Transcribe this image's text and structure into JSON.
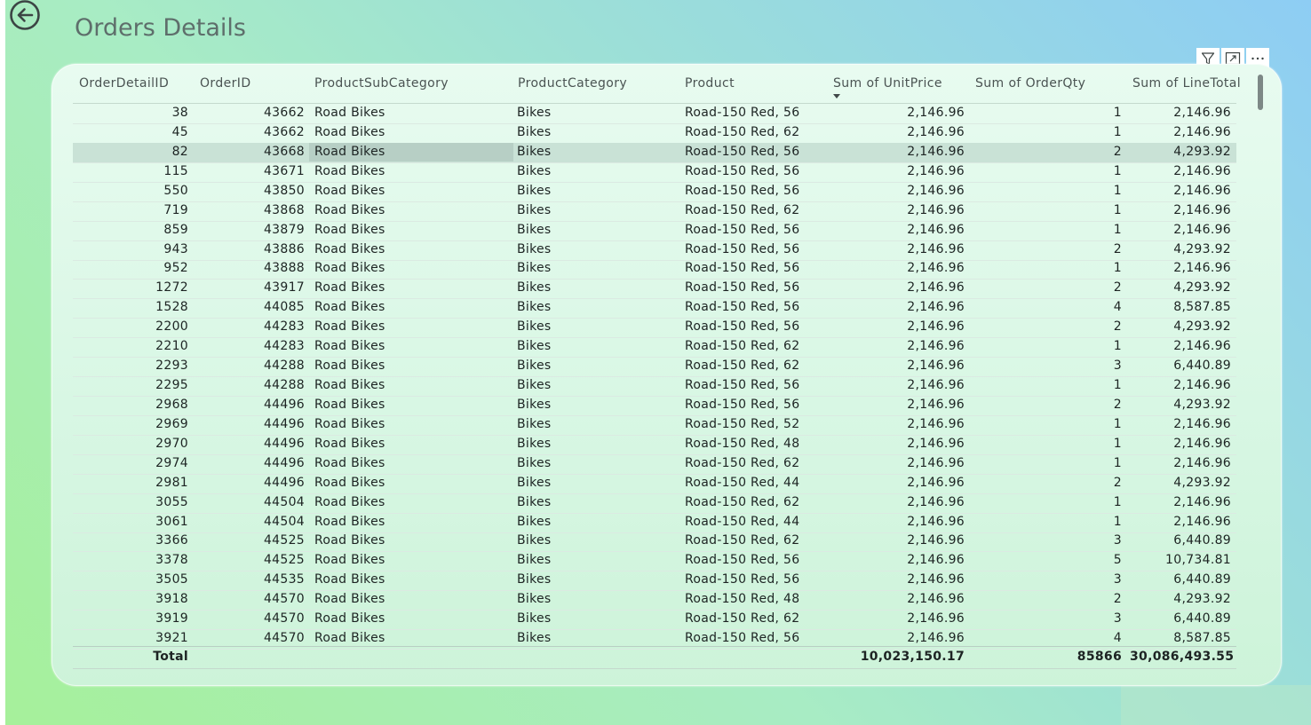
{
  "page": {
    "title": "Orders Details"
  },
  "toolbar": {
    "icons": [
      "filter-icon",
      "focus-mode-icon",
      "more-options-icon"
    ]
  },
  "table": {
    "columns": [
      "OrderDetailID",
      "OrderID",
      "ProductSubCategory",
      "ProductCategory",
      "Product",
      "Sum of UnitPrice",
      "Sum of OrderQty",
      "Sum of LineTotal"
    ],
    "sorted_column": "Sum of UnitPrice",
    "selected_row": 2,
    "rows": [
      [
        "38",
        "43662",
        "Road Bikes",
        "Bikes",
        "Road-150 Red, 56",
        "2,146.96",
        "1",
        "2,146.96"
      ],
      [
        "45",
        "43662",
        "Road Bikes",
        "Bikes",
        "Road-150 Red, 62",
        "2,146.96",
        "1",
        "2,146.96"
      ],
      [
        "82",
        "43668",
        "Road Bikes",
        "Bikes",
        "Road-150 Red, 56",
        "2,146.96",
        "2",
        "4,293.92"
      ],
      [
        "115",
        "43671",
        "Road Bikes",
        "Bikes",
        "Road-150 Red, 56",
        "2,146.96",
        "1",
        "2,146.96"
      ],
      [
        "550",
        "43850",
        "Road Bikes",
        "Bikes",
        "Road-150 Red, 56",
        "2,146.96",
        "1",
        "2,146.96"
      ],
      [
        "719",
        "43868",
        "Road Bikes",
        "Bikes",
        "Road-150 Red, 62",
        "2,146.96",
        "1",
        "2,146.96"
      ],
      [
        "859",
        "43879",
        "Road Bikes",
        "Bikes",
        "Road-150 Red, 56",
        "2,146.96",
        "1",
        "2,146.96"
      ],
      [
        "943",
        "43886",
        "Road Bikes",
        "Bikes",
        "Road-150 Red, 56",
        "2,146.96",
        "2",
        "4,293.92"
      ],
      [
        "952",
        "43888",
        "Road Bikes",
        "Bikes",
        "Road-150 Red, 56",
        "2,146.96",
        "1",
        "2,146.96"
      ],
      [
        "1272",
        "43917",
        "Road Bikes",
        "Bikes",
        "Road-150 Red, 56",
        "2,146.96",
        "2",
        "4,293.92"
      ],
      [
        "1528",
        "44085",
        "Road Bikes",
        "Bikes",
        "Road-150 Red, 56",
        "2,146.96",
        "4",
        "8,587.85"
      ],
      [
        "2200",
        "44283",
        "Road Bikes",
        "Bikes",
        "Road-150 Red, 56",
        "2,146.96",
        "2",
        "4,293.92"
      ],
      [
        "2210",
        "44283",
        "Road Bikes",
        "Bikes",
        "Road-150 Red, 62",
        "2,146.96",
        "1",
        "2,146.96"
      ],
      [
        "2293",
        "44288",
        "Road Bikes",
        "Bikes",
        "Road-150 Red, 62",
        "2,146.96",
        "3",
        "6,440.89"
      ],
      [
        "2295",
        "44288",
        "Road Bikes",
        "Bikes",
        "Road-150 Red, 56",
        "2,146.96",
        "1",
        "2,146.96"
      ],
      [
        "2968",
        "44496",
        "Road Bikes",
        "Bikes",
        "Road-150 Red, 56",
        "2,146.96",
        "2",
        "4,293.92"
      ],
      [
        "2969",
        "44496",
        "Road Bikes",
        "Bikes",
        "Road-150 Red, 52",
        "2,146.96",
        "1",
        "2,146.96"
      ],
      [
        "2970",
        "44496",
        "Road Bikes",
        "Bikes",
        "Road-150 Red, 48",
        "2,146.96",
        "1",
        "2,146.96"
      ],
      [
        "2974",
        "44496",
        "Road Bikes",
        "Bikes",
        "Road-150 Red, 62",
        "2,146.96",
        "1",
        "2,146.96"
      ],
      [
        "2981",
        "44496",
        "Road Bikes",
        "Bikes",
        "Road-150 Red, 44",
        "2,146.96",
        "2",
        "4,293.92"
      ],
      [
        "3055",
        "44504",
        "Road Bikes",
        "Bikes",
        "Road-150 Red, 62",
        "2,146.96",
        "1",
        "2,146.96"
      ],
      [
        "3061",
        "44504",
        "Road Bikes",
        "Bikes",
        "Road-150 Red, 44",
        "2,146.96",
        "1",
        "2,146.96"
      ],
      [
        "3366",
        "44525",
        "Road Bikes",
        "Bikes",
        "Road-150 Red, 62",
        "2,146.96",
        "3",
        "6,440.89"
      ],
      [
        "3378",
        "44525",
        "Road Bikes",
        "Bikes",
        "Road-150 Red, 56",
        "2,146.96",
        "5",
        "10,734.81"
      ],
      [
        "3505",
        "44535",
        "Road Bikes",
        "Bikes",
        "Road-150 Red, 56",
        "2,146.96",
        "3",
        "6,440.89"
      ],
      [
        "3918",
        "44570",
        "Road Bikes",
        "Bikes",
        "Road-150 Red, 48",
        "2,146.96",
        "2",
        "4,293.92"
      ],
      [
        "3919",
        "44570",
        "Road Bikes",
        "Bikes",
        "Road-150 Red, 62",
        "2,146.96",
        "3",
        "6,440.89"
      ],
      [
        "3921",
        "44570",
        "Road Bikes",
        "Bikes",
        "Road-150 Red, 56",
        "2,146.96",
        "4",
        "8,587.85"
      ]
    ],
    "total": {
      "label": "Total",
      "unit_price": "10,023,150.17",
      "order_qty": "85866",
      "line_total": "30,086,493.55"
    }
  }
}
